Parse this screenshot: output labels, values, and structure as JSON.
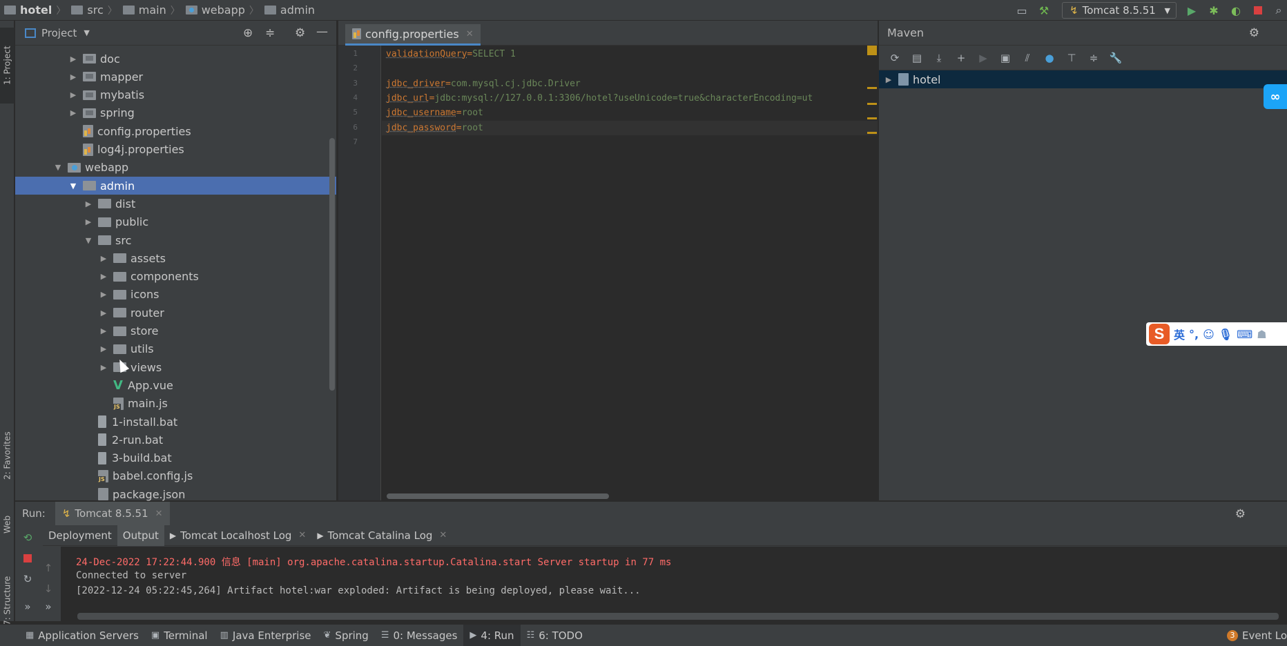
{
  "breadcrumb": [
    {
      "label": "hotel",
      "icon": "module-icon"
    },
    {
      "label": "src",
      "icon": "folder-icon"
    },
    {
      "label": "main",
      "icon": "folder-icon"
    },
    {
      "label": "webapp",
      "icon": "web-folder-icon"
    },
    {
      "label": "admin",
      "icon": "folder-icon"
    }
  ],
  "toolbar": {
    "run_config": "Tomcat 8.5.51"
  },
  "left_strip": {
    "project": "1: Project",
    "favorites": "2: Favorites",
    "web": "Web",
    "structure": "7: Structure"
  },
  "project_panel": {
    "title": "Project",
    "tree": [
      {
        "label": "doc",
        "type": "folder",
        "depth": 1,
        "expanded": false
      },
      {
        "label": "mapper",
        "type": "folder",
        "depth": 1,
        "expanded": false
      },
      {
        "label": "mybatis",
        "type": "folder",
        "depth": 1,
        "expanded": false
      },
      {
        "label": "spring",
        "type": "folder",
        "depth": 1,
        "expanded": false
      },
      {
        "label": "config.properties",
        "type": "properties",
        "depth": 1
      },
      {
        "label": "log4j.properties",
        "type": "properties",
        "depth": 1
      },
      {
        "label": "webapp",
        "type": "webfolder",
        "depth": 0,
        "expanded": true
      },
      {
        "label": "admin",
        "type": "folder",
        "depth": 1,
        "expanded": true,
        "selected": true
      },
      {
        "label": "dist",
        "type": "folder",
        "depth": 2,
        "expanded": false
      },
      {
        "label": "public",
        "type": "folder",
        "depth": 2,
        "expanded": false
      },
      {
        "label": "src",
        "type": "folder",
        "depth": 2,
        "expanded": true
      },
      {
        "label": "assets",
        "type": "folder",
        "depth": 3,
        "expanded": false
      },
      {
        "label": "components",
        "type": "folder",
        "depth": 3,
        "expanded": false
      },
      {
        "label": "icons",
        "type": "folder",
        "depth": 3,
        "expanded": false
      },
      {
        "label": "router",
        "type": "folder",
        "depth": 3,
        "expanded": false
      },
      {
        "label": "store",
        "type": "folder",
        "depth": 3,
        "expanded": false
      },
      {
        "label": "utils",
        "type": "folder",
        "depth": 3,
        "expanded": false
      },
      {
        "label": "views",
        "type": "folder",
        "depth": 3,
        "expanded": false
      },
      {
        "label": "App.vue",
        "type": "vue",
        "depth": 3
      },
      {
        "label": "main.js",
        "type": "js",
        "depth": 3
      },
      {
        "label": "1-install.bat",
        "type": "bat",
        "depth": 2
      },
      {
        "label": "2-run.bat",
        "type": "bat",
        "depth": 2
      },
      {
        "label": "3-build.bat",
        "type": "bat",
        "depth": 2
      },
      {
        "label": "babel.config.js",
        "type": "js",
        "depth": 2
      },
      {
        "label": "package.json",
        "type": "json",
        "depth": 2
      }
    ]
  },
  "editor": {
    "tab_label": "config.properties",
    "lines": [
      {
        "num": "1",
        "key": "validationQuery",
        "value": "SELECT 1"
      },
      {
        "num": "2",
        "key": "",
        "value": ""
      },
      {
        "num": "3",
        "key": "jdbc_driver",
        "value": "com.mysql.cj.jdbc.Driver"
      },
      {
        "num": "4",
        "key": "jdbc_url",
        "value": "jdbc:mysql://127.0.0.1:3306/hotel?useUnicode=true&characterEncoding=ut"
      },
      {
        "num": "5",
        "key": "jdbc_username",
        "value": "root"
      },
      {
        "num": "6",
        "key": "jdbc_password",
        "value": "root"
      },
      {
        "num": "7",
        "key": "",
        "value": ""
      }
    ],
    "current_line": "6"
  },
  "maven": {
    "title": "Maven",
    "root": "hotel"
  },
  "run": {
    "label": "Run:",
    "config_tab": "Tomcat 8.5.51",
    "subtabs": [
      "Deployment",
      "Output",
      "Tomcat Localhost Log",
      "Tomcat Catalina Log"
    ],
    "active_subtab": "Output",
    "console": [
      {
        "text": "24-Dec-2022 17:22:44.900 信息 [main] org.apache.catalina.startup.Catalina.start Server startup in 77 ms",
        "color": "#ff6b68"
      },
      {
        "text": "Connected to server",
        "color": "#bbbbbb"
      },
      {
        "text": "[2022-12-24 05:22:45,264] Artifact hotel:war exploded: Artifact is being deployed, please wait...",
        "color": "#bbbbbb"
      }
    ]
  },
  "statusbar": [
    {
      "label": "Application Servers",
      "icon": "server-icon"
    },
    {
      "label": "Terminal",
      "icon": "terminal-icon"
    },
    {
      "label": "Java Enterprise",
      "icon": "java-icon"
    },
    {
      "label": "Spring",
      "icon": "spring-icon"
    },
    {
      "label": "0: Messages",
      "icon": "messages-icon"
    },
    {
      "label": "4: Run",
      "icon": "run-icon",
      "active": true
    },
    {
      "label": "6: TODO",
      "icon": "todo-icon"
    }
  ],
  "event_log": {
    "count": "3",
    "label": "Event Lo"
  },
  "ime": {
    "logo": "S",
    "lang": "英"
  }
}
